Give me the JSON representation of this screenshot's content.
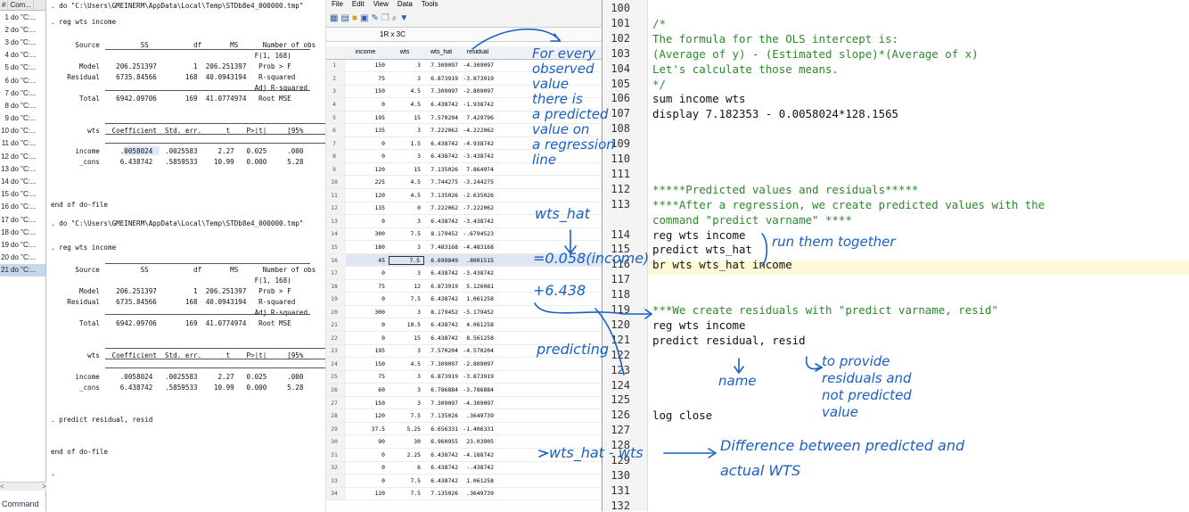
{
  "history": {
    "header": [
      "#",
      "Com..."
    ],
    "rows": [
      [
        "1",
        "do \"C:..."
      ],
      [
        "2",
        "do \"C:..."
      ],
      [
        "3",
        "do \"C:..."
      ],
      [
        "4",
        "do \"C:..."
      ],
      [
        "5",
        "do \"C:..."
      ],
      [
        "6",
        "do \"C:..."
      ],
      [
        "7",
        "do \"C:..."
      ],
      [
        "8",
        "do \"C:..."
      ],
      [
        "9",
        "do \"C:..."
      ],
      [
        "10",
        "do \"C:..."
      ],
      [
        "11",
        "do \"C:..."
      ],
      [
        "12",
        "do \"C:..."
      ],
      [
        "13",
        "do \"C:..."
      ],
      [
        "14",
        "do \"C:..."
      ],
      [
        "15",
        "do \"C:..."
      ],
      [
        "16",
        "do \"C:..."
      ],
      [
        "17",
        "do \"C:..."
      ],
      [
        "18",
        "do \"C:..."
      ],
      [
        "19",
        "do \"C:..."
      ],
      [
        "20",
        "do \"C:..."
      ],
      [
        "21",
        "do \"C:..."
      ]
    ],
    "scroll_left": "<",
    "scroll_right": ">"
  },
  "command_label": "Command",
  "results": {
    "lines": [
      ". do \"C:\\Users\\GMEINERM\\AppData\\Local\\Temp\\STDb8e4_000000.tmp\"",
      ". reg wts income",
      "      Source          SS           df       MS      Number of obs",
      "                                                  F(1, 168)",
      "       Model    206.251397         1  206.251397   Prob > F",
      "    Residual    6735.84566       168  40.0943194   R-squared",
      "                                                  Adj R-squared",
      "       Total    6942.09706       169  41.0774974   Root MSE",
      "         wts   Coefficient  Std. err.      t    P>|t|     [95%",
      "      income     .0058024   .0025583     2.27   0.025     .000",
      "       _cons     6.438742   .5859533    10.99   0.000     5.28",
      "end of do-file",
      ". do \"C:\\Users\\GMEINERM\\AppData\\Local\\Temp\\STDb8e4_000000.tmp\"",
      ". reg wts income",
      "      Source          SS           df       MS      Number of obs",
      "                                                  F(1, 168)",
      "       Model    206.251397         1  206.251397   Prob > F",
      "    Residual    6735.84566       168  40.0943194   R-squared",
      "                                                  Adj R-squared",
      "       Total    6942.09706       169  41.0774974   Root MSE",
      "         wts   Coefficient  Std. err.      t    P>|t|     [95%",
      "      income     .0058024   .0025583     2.27   0.025     .000",
      "       _cons     6.438742   .5859533    10.99   0.000     5.28",
      ". predict residual, resid",
      "end of do-file",
      "."
    ]
  },
  "browser": {
    "menu": [
      "File",
      "Edit",
      "View",
      "Data",
      "Tools"
    ],
    "cellref": "1R x 3C",
    "columns": [
      "income",
      "wts",
      "wts_hat",
      "residual"
    ],
    "rows": [
      [
        "1",
        "150",
        "3",
        "7.309097",
        "-4.309097"
      ],
      [
        "2",
        "75",
        "3",
        "6.873919",
        "-3.873919"
      ],
      [
        "3",
        "150",
        "4.5",
        "7.309097",
        "-2.809097"
      ],
      [
        "4",
        "0",
        "4.5",
        "6.438742",
        "-1.938742"
      ],
      [
        "5",
        "195",
        "15",
        "7.570204",
        "7.429796"
      ],
      [
        "6",
        "135",
        "3",
        "7.222062",
        "-4.222062"
      ],
      [
        "7",
        "0",
        "1.5",
        "6.438742",
        "-4.938742"
      ],
      [
        "8",
        "0",
        "3",
        "6.438742",
        "-3.438742"
      ],
      [
        "9",
        "120",
        "15",
        "7.135026",
        "7.864974"
      ],
      [
        "10",
        "225",
        "4.5",
        "7.744275",
        "-3.244275"
      ],
      [
        "11",
        "120",
        "4.5",
        "7.135026",
        "-2.635026"
      ],
      [
        "12",
        "135",
        "0",
        "7.222062",
        "-7.222062"
      ],
      [
        "13",
        "0",
        "3",
        "6.438742",
        "-3.438742"
      ],
      [
        "14",
        "300",
        "7.5",
        "8.179452",
        "-.6794523"
      ],
      [
        "15",
        "180",
        "3",
        "7.483168",
        "-4.483168"
      ],
      [
        "16",
        "45",
        "7.5",
        "6.699849",
        ".8001515"
      ],
      [
        "17",
        "0",
        "3",
        "6.438742",
        "-3.438742"
      ],
      [
        "18",
        "75",
        "12",
        "6.873919",
        "5.126081"
      ],
      [
        "19",
        "0",
        "7.5",
        "6.438742",
        "1.061258"
      ],
      [
        "20",
        "300",
        "3",
        "8.179452",
        "-5.179452"
      ],
      [
        "21",
        "0",
        "10.5",
        "6.438742",
        "4.061258"
      ],
      [
        "22",
        "0",
        "15",
        "6.438742",
        "8.561258"
      ],
      [
        "23",
        "195",
        "3",
        "7.570204",
        "-4.570204"
      ],
      [
        "24",
        "150",
        "4.5",
        "7.309097",
        "-2.809097"
      ],
      [
        "25",
        "75",
        "3",
        "6.873919",
        "-3.873919"
      ],
      [
        "26",
        "60",
        "3",
        "6.786884",
        "-3.786884"
      ],
      [
        "27",
        "150",
        "3",
        "7.309097",
        "-4.309097"
      ],
      [
        "28",
        "120",
        "7.5",
        "7.135026",
        ".3649739"
      ],
      [
        "29",
        "37.5",
        "5.25",
        "6.656331",
        "-1.406331"
      ],
      [
        "30",
        "90",
        "30",
        "6.960955",
        "23.03905"
      ],
      [
        "31",
        "0",
        "2.25",
        "6.438742",
        "-4.188742"
      ],
      [
        "32",
        "0",
        "6",
        "6.438742",
        "-.438742"
      ],
      [
        "33",
        "0",
        "7.5",
        "6.438742",
        "1.061258"
      ],
      [
        "34",
        "120",
        "7.5",
        "7.135026",
        ".3649739"
      ]
    ]
  },
  "editor": {
    "lines": [
      {
        "n": "100",
        "t": "",
        "c": "cd"
      },
      {
        "n": "101",
        "t": "/*",
        "c": "cm"
      },
      {
        "n": "102",
        "t": "The formula for the OLS intercept is:",
        "c": "cm"
      },
      {
        "n": "103",
        "t": "(Average of y) - (Estimated slope)*(Average of x)",
        "c": "cm"
      },
      {
        "n": "104",
        "t": "Let's calculate those means.",
        "c": "cm"
      },
      {
        "n": "105",
        "t": "*/",
        "c": "cm"
      },
      {
        "n": "106",
        "t": "sum income wts",
        "c": "cd"
      },
      {
        "n": "107",
        "t": "display 7.182353 - 0.0058024*128.1565",
        "c": "cd"
      },
      {
        "n": "108",
        "t": "",
        "c": "cd"
      },
      {
        "n": "109",
        "t": "",
        "c": "cd"
      },
      {
        "n": "110",
        "t": "",
        "c": "cd"
      },
      {
        "n": "111",
        "t": "",
        "c": "cd"
      },
      {
        "n": "112",
        "t": "*****Predicted values and residuals*****",
        "c": "cm"
      },
      {
        "n": "113",
        "t": "****After a regression, we create predicted values with the",
        "c": "cm"
      },
      {
        "n": "",
        "t": "command \"predict varname\" ****",
        "c": "cm"
      },
      {
        "n": "114",
        "t": "reg wts income",
        "c": "cd"
      },
      {
        "n": "115",
        "t": "predict wts_hat",
        "c": "cd"
      },
      {
        "n": "116",
        "t": "br wts wts_hat income",
        "c": "cd"
      },
      {
        "n": "117",
        "t": "",
        "c": "cd"
      },
      {
        "n": "118",
        "t": "",
        "c": "cd"
      },
      {
        "n": "119",
        "t": "***We create residuals with \"predict varname, resid\"",
        "c": "cm"
      },
      {
        "n": "120",
        "t": "reg wts income",
        "c": "cd"
      },
      {
        "n": "121",
        "t": "predict residual, resid",
        "c": "cd"
      },
      {
        "n": "122",
        "t": "",
        "c": "cd"
      },
      {
        "n": "123",
        "t": "",
        "c": "cd"
      },
      {
        "n": "124",
        "t": "",
        "c": "cd"
      },
      {
        "n": "125",
        "t": "",
        "c": "cd"
      },
      {
        "n": "126",
        "t": "log close",
        "c": "cd"
      },
      {
        "n": "127",
        "t": "",
        "c": "cd"
      },
      {
        "n": "128",
        "t": "",
        "c": "cd"
      },
      {
        "n": "129",
        "t": "",
        "c": "cd"
      },
      {
        "n": "130",
        "t": "",
        "c": "cd"
      },
      {
        "n": "131",
        "t": "",
        "c": "cd"
      },
      {
        "n": "132",
        "t": "",
        "c": "cd"
      }
    ]
  },
  "annotations": {
    "a1": "For every",
    "a2": "observed",
    "a3": "value",
    "a4": "there is",
    "a5": "a predicted",
    "a6": "value on",
    "a7": "a regression",
    "a8": "line",
    "a9": "wts_hat",
    "a10": "=0.058(income)",
    "a11": "+6.438",
    "a12": "predicting",
    "a13": "wts_hat - wts",
    "a14": "Difference between predicted and",
    "a15": "actual WTS",
    "a16": "run them together",
    "a17": "name",
    "a18": "to provide",
    "a19": "residuals and",
    "a20": "not predicted",
    "a21": "value"
  }
}
